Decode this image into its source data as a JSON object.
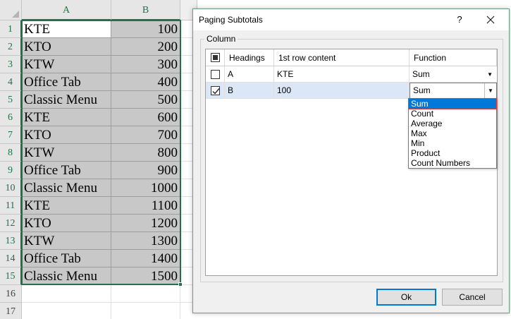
{
  "sheet": {
    "columns": [
      "A",
      "B"
    ],
    "rows": [
      {
        "n": "1",
        "a": "KTE",
        "b": "100"
      },
      {
        "n": "2",
        "a": "KTO",
        "b": "200"
      },
      {
        "n": "3",
        "a": "KTW",
        "b": "300"
      },
      {
        "n": "4",
        "a": "Office Tab",
        "b": "400"
      },
      {
        "n": "5",
        "a": "Classic Menu",
        "b": "500"
      },
      {
        "n": "6",
        "a": "KTE",
        "b": "600"
      },
      {
        "n": "7",
        "a": "KTO",
        "b": "700"
      },
      {
        "n": "8",
        "a": "KTW",
        "b": "800"
      },
      {
        "n": "9",
        "a": "Office Tab",
        "b": "900"
      },
      {
        "n": "10",
        "a": "Classic Menu",
        "b": "1000"
      },
      {
        "n": "11",
        "a": "KTE",
        "b": "1100"
      },
      {
        "n": "12",
        "a": "KTO",
        "b": "1200"
      },
      {
        "n": "13",
        "a": "KTW",
        "b": "1300"
      },
      {
        "n": "14",
        "a": "Office Tab",
        "b": "1400"
      },
      {
        "n": "15",
        "a": "Classic Menu",
        "b": "1500"
      },
      {
        "n": "16",
        "a": "",
        "b": ""
      },
      {
        "n": "17",
        "a": "",
        "b": ""
      }
    ],
    "accent_color": "#217346"
  },
  "dialog": {
    "title": "Paging Subtotals",
    "help_label": "?",
    "group_label": "Column",
    "headers": {
      "headings": "Headings",
      "first_row": "1st row content",
      "function": "Function"
    },
    "rows": [
      {
        "checked": false,
        "heading": "A",
        "first_row": "KTE",
        "function": "Sum"
      },
      {
        "checked": true,
        "heading": "B",
        "first_row": "100",
        "function": "Sum"
      }
    ],
    "function_options": [
      "Sum",
      "Count",
      "Average",
      "Max",
      "Min",
      "Product",
      "Count Numbers"
    ],
    "selected_option": "Sum",
    "ok_label": "Ok",
    "cancel_label": "Cancel",
    "select_color": "#0078d7"
  }
}
